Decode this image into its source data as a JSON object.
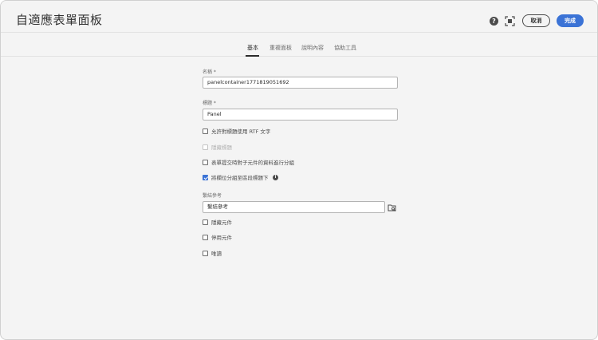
{
  "header": {
    "title": "自適應表單面板",
    "help_icon": "?",
    "cancel_label": "取消",
    "done_label": "完成"
  },
  "tabs": [
    {
      "label": "基本",
      "active": true
    },
    {
      "label": "重複面板",
      "active": false
    },
    {
      "label": "說明內容",
      "active": false
    },
    {
      "label": "協助工具",
      "active": false
    }
  ],
  "form": {
    "name_label": "名稱 *",
    "name_value": "panelcontainer1771819051692",
    "title_label": "標題 *",
    "title_value": "Panel",
    "rich_text_label": "允許對標題使用  RTF  文字",
    "hide_title_label": "隱藏標題",
    "group_data_label": "表單提交時對子元件的資料進行分組",
    "wrap_fields_label": "將欄位分組至區段標題下",
    "bind_ref_label": "繫結參考",
    "bind_ref_placeholder": "繫結參考",
    "hide_component_label": "隱藏元件",
    "disable_component_label": "停用元件",
    "readonly_label": "唯讀"
  },
  "colors": {
    "accent": "#3b73d6",
    "background": "#f4f4f4"
  },
  "icons": {
    "help": "help-icon",
    "fullscreen": "fullscreen-icon",
    "info": "info-icon",
    "browse": "folder-browse-icon"
  }
}
